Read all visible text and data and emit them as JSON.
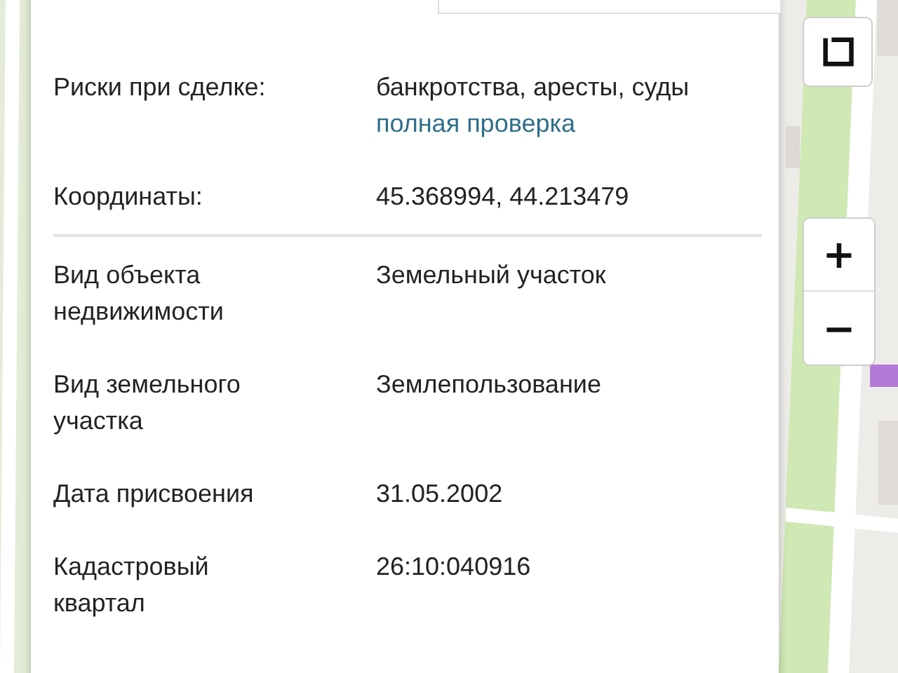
{
  "info_panel": {
    "sections": [
      {
        "rows": [
          {
            "label": "Риски при сделке:",
            "value": "банкротства, аресты, суды",
            "link": "полная проверка"
          },
          {
            "label": "Координаты:",
            "value": "45.368994, 44.213479"
          }
        ]
      },
      {
        "rows": [
          {
            "label": "Вид объекта недвижимости",
            "value": "Земельный участок"
          },
          {
            "label": "Вид земельного участка",
            "value": "Землепользование"
          },
          {
            "label": "Дата присвоения",
            "value": "31.05.2002"
          },
          {
            "label": "Кадастровый квартал",
            "value": "26:10:040916"
          }
        ]
      }
    ]
  },
  "map_controls": {
    "buttons": [
      {
        "kind": "layers"
      },
      {
        "kind": "zoom_in",
        "label": "+"
      },
      {
        "kind": "zoom_out",
        "label": "−"
      }
    ]
  }
}
